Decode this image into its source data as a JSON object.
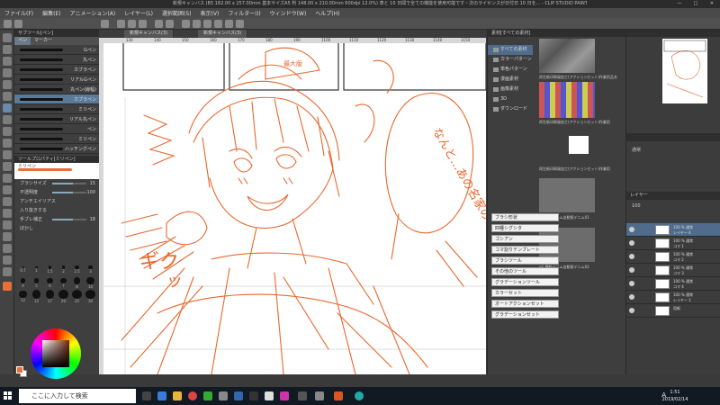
{
  "window": {
    "title": "新規キャンバス (B5 182.00 x 257.00mm 基本サイズA5 判 148.00 x 210.00mm 600dpi 12.0%) 表と 10 日間で全ての機能を使用可能です・次のライセンスが日付日 10 日を... - CLIP STUDIO PAINT PRO",
    "controls": [
      "—",
      "□",
      "✕"
    ]
  },
  "menu": [
    "ファイル(F)",
    "編集(E)",
    "アニメーション(A)",
    "レイヤー(L)",
    "選択範囲(S)",
    "表示(V)",
    "フィルター(I)",
    "ウィンドウ(W)",
    "ヘルプ(H)"
  ],
  "subtool": {
    "header": "サブツール[ペン]",
    "tabs": [
      "ペン",
      "マーカー"
    ],
    "brushes": [
      "Gペン",
      "丸ペン",
      "カブラペン",
      "リアルGペン",
      "丸ペン(線幅)",
      "カブラペン",
      "ミリペン",
      "リアル丸ペン",
      "ペン",
      "ミリペン",
      "ハッチングペン"
    ],
    "selected_index": 5,
    "props_header": "ツールプロパティ[ミリペン]",
    "props_preview": "ミリペン",
    "props": [
      {
        "label": "ブラシサイズ",
        "value": "15"
      },
      {
        "label": "不透明度",
        "value": "100"
      },
      {
        "label": "アンチエイリアス",
        "value": ""
      },
      {
        "label": "入り抜きする",
        "value": ""
      },
      {
        "label": "手ブレ補正",
        "value": "18"
      },
      {
        "label": "ぼかし",
        "value": ""
      }
    ],
    "brush_sizes": [
      "0.7",
      "1",
      "1.5",
      "2",
      "2.5",
      "3",
      "4",
      "5",
      "6",
      "7",
      "8",
      "10",
      "12",
      "15",
      "17",
      "20",
      "25",
      "30"
    ]
  },
  "canvas": {
    "tabs": [
      "新規キャンバス(3)",
      "新規キャンバス(3)"
    ],
    "ruler_ticks": [
      "130",
      "140",
      "150",
      "160",
      "170",
      "180",
      "190",
      "1100",
      "1110",
      "1120",
      "1130",
      "1140",
      "1150"
    ],
    "speech_bubble": "なんと...あの名家の...",
    "sketch_sfx": [
      "ギク",
      "ッ"
    ],
    "panel_note": "最大版"
  },
  "material": {
    "header": "素材[すべての素材]",
    "tree": [
      "すべての素材",
      "カラーパターン",
      "単色パターン",
      "漫画素材",
      "画像素材",
      "3D",
      "ダウンロード"
    ],
    "selected_index": 0,
    "items": [
      "再生紙印刷風加工(アクションセット)作業用品名",
      "再生紙印刷風加工(アクションセット)作業用",
      "再生紙印刷風加工(アクションセット)作業用",
      "oil_鏡紋デニム自動版デニム01",
      "oil_鏡紋デニム自動版デニム02"
    ]
  },
  "autoactions": [
    "ブラシ形状",
    "四種シグシタ",
    "ゴシアン",
    "コマ割りテンプレート",
    "ブラシツール",
    "その他のツール",
    "グラデーションツール",
    "カラーセット",
    "オートアクションセット",
    "グラデーションセット"
  ],
  "layers": {
    "header": "レイヤー",
    "mode": "通常",
    "opacity": "100",
    "items": [
      {
        "name": "100 % 通常",
        "sub": "レイヤー 4"
      },
      {
        "name": "100 % 通常",
        "sub": "コマ 1"
      },
      {
        "name": "100 % 通常",
        "sub": "コマ 2"
      },
      {
        "name": "100 % 通常",
        "sub": "コマ 3"
      },
      {
        "name": "100 % 通常",
        "sub": "コマ 4"
      },
      {
        "name": "100 % 通常",
        "sub": "レイヤー 1"
      },
      {
        "name": "用紙",
        "sub": ""
      }
    ],
    "selected_index": 0
  },
  "color": {
    "main": "#e87038",
    "sub": "#ffffff"
  },
  "taskbar": {
    "search_placeholder": "ここに入力して検索",
    "time": "1:51",
    "date": "2019/02/14",
    "ime": "A"
  }
}
